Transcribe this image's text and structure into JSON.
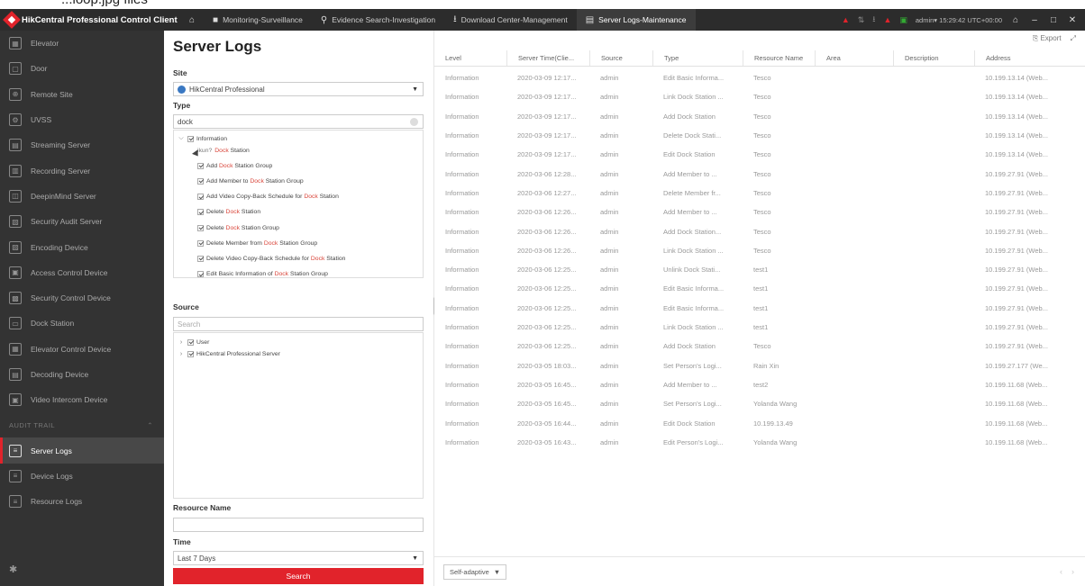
{
  "caption": "...loop.jpg files",
  "titlebar": {
    "app_name": "HikCentral Professional Control Client",
    "tabs": [
      {
        "label": "Monitoring-Surveillance"
      },
      {
        "label": "Evidence Search-Investigation"
      },
      {
        "label": "Download Center-Management"
      },
      {
        "label": "Server Logs-Maintenance"
      }
    ],
    "user": "admin▾ 15:29:42 UTC+00:00"
  },
  "sidebar": {
    "items": [
      {
        "label": "Elevator",
        "icon": "elevator-icon"
      },
      {
        "label": "Door",
        "icon": "door-icon"
      },
      {
        "label": "Remote Site",
        "icon": "remote-site-icon"
      },
      {
        "label": "UVSS",
        "icon": "uvss-icon"
      },
      {
        "label": "Streaming Server",
        "icon": "streaming-server-icon"
      },
      {
        "label": "Recording Server",
        "icon": "recording-server-icon"
      },
      {
        "label": "DeepinMind Server",
        "icon": "deepinmind-icon"
      },
      {
        "label": "Security Audit Server",
        "icon": "audit-server-icon"
      },
      {
        "label": "Encoding Device",
        "icon": "encoding-device-icon"
      },
      {
        "label": "Access Control Device",
        "icon": "access-control-icon"
      },
      {
        "label": "Security Control Device",
        "icon": "security-control-icon"
      },
      {
        "label": "Dock Station",
        "icon": "dock-station-icon"
      },
      {
        "label": "Elevator Control Device",
        "icon": "elevator-control-icon"
      },
      {
        "label": "Decoding Device",
        "icon": "decoding-device-icon"
      },
      {
        "label": "Video Intercom Device",
        "icon": "video-intercom-icon"
      }
    ],
    "section": "AUDIT TRAIL",
    "audit_items": [
      {
        "label": "Server Logs",
        "active": true
      },
      {
        "label": "Device Logs",
        "active": false
      },
      {
        "label": "Resource Logs",
        "active": false
      }
    ]
  },
  "filter": {
    "title": "Server Logs",
    "site_label": "Site",
    "site_value": "HikCentral Professional",
    "type_label": "Type",
    "type_value": "dock",
    "type_tree": {
      "parent": "Information",
      "ghost": "ikun?",
      "children": [
        {
          "pre": "",
          "hl": "Dock",
          "post": " Station"
        },
        {
          "pre": "Add ",
          "hl": "Dock",
          "post": " Station Group"
        },
        {
          "pre": "Add Member to ",
          "hl": "Dock",
          "post": " Station Group"
        },
        {
          "pre": "Add Video Copy-Back Schedule for ",
          "hl": "Dock",
          "post": " Station"
        },
        {
          "pre": "Delete ",
          "hl": "Dock",
          "post": " Station"
        },
        {
          "pre": "Delete ",
          "hl": "Dock",
          "post": " Station Group"
        },
        {
          "pre": "Delete Member from ",
          "hl": "Dock",
          "post": " Station Group"
        },
        {
          "pre": "Delete Video Copy-Back Schedule for ",
          "hl": "Dock",
          "post": " Station"
        },
        {
          "pre": "Edit Basic Information of ",
          "hl": "Dock",
          "post": " Station Group"
        }
      ]
    },
    "source_label": "Source",
    "source_placeholder": "Search",
    "source_tree": [
      "User",
      "HikCentral Professional Server"
    ],
    "resource_label": "Resource Name",
    "resource_value": "",
    "time_label": "Time",
    "time_value": "Last 7 Days",
    "search_label": "Search"
  },
  "table": {
    "export_label": "Export",
    "columns": [
      "Level",
      "Server Time(Clie...",
      "Source",
      "Type",
      "Resource Name",
      "Area",
      "Description",
      "Address"
    ],
    "rows": [
      [
        "Information",
        "2020-03-09 12:17...",
        "admin",
        "Edit Basic Informa...",
        "Tesco",
        "",
        "",
        "10.199.13.14 (Web..."
      ],
      [
        "Information",
        "2020-03-09 12:17...",
        "admin",
        "Link Dock Station ...",
        "Tesco",
        "",
        "",
        "10.199.13.14 (Web..."
      ],
      [
        "Information",
        "2020-03-09 12:17...",
        "admin",
        "Add Dock Station",
        "Tesco",
        "",
        "",
        "10.199.13.14 (Web..."
      ],
      [
        "Information",
        "2020-03-09 12:17...",
        "admin",
        "Delete Dock Stati...",
        "Tesco",
        "",
        "",
        "10.199.13.14 (Web..."
      ],
      [
        "Information",
        "2020-03-09 12:17...",
        "admin",
        "Edit Dock Station",
        "Tesco",
        "",
        "",
        "10.199.13.14 (Web..."
      ],
      [
        "Information",
        "2020-03-06 12:28...",
        "admin",
        "Add Member to ...",
        "Tesco",
        "",
        "",
        "10.199.27.91 (Web..."
      ],
      [
        "Information",
        "2020-03-06 12:27...",
        "admin",
        "Delete Member fr...",
        "Tesco",
        "",
        "",
        "10.199.27.91 (Web..."
      ],
      [
        "Information",
        "2020-03-06 12:26...",
        "admin",
        "Add Member to ...",
        "Tesco",
        "",
        "",
        "10.199.27.91 (Web..."
      ],
      [
        "Information",
        "2020-03-06 12:26...",
        "admin",
        "Add Dock Station...",
        "Tesco",
        "",
        "",
        "10.199.27.91 (Web..."
      ],
      [
        "Information",
        "2020-03-06 12:26...",
        "admin",
        "Link Dock Station ...",
        "Tesco",
        "",
        "",
        "10.199.27.91 (Web..."
      ],
      [
        "Information",
        "2020-03-06 12:25...",
        "admin",
        "Unlink Dock Stati...",
        "test1",
        "",
        "",
        "10.199.27.91 (Web..."
      ],
      [
        "Information",
        "2020-03-06 12:25...",
        "admin",
        "Edit Basic Informa...",
        "test1",
        "",
        "",
        "10.199.27.91 (Web..."
      ],
      [
        "Information",
        "2020-03-06 12:25...",
        "admin",
        "Edit Basic Informa...",
        "test1",
        "",
        "",
        "10.199.27.91 (Web..."
      ],
      [
        "Information",
        "2020-03-06 12:25...",
        "admin",
        "Link Dock Station ...",
        "test1",
        "",
        "",
        "10.199.27.91 (Web..."
      ],
      [
        "Information",
        "2020-03-06 12:25...",
        "admin",
        "Add Dock Station",
        "Tesco",
        "",
        "",
        "10.199.27.91 (Web..."
      ],
      [
        "Information",
        "2020-03-05 18:03...",
        "admin",
        "Set Person's Logi...",
        "Rain Xin",
        "",
        "",
        "10.199.27.177 (We..."
      ],
      [
        "Information",
        "2020-03-05 16:45...",
        "admin",
        "Add Member to ...",
        "test2",
        "",
        "",
        "10.199.11.68 (Web..."
      ],
      [
        "Information",
        "2020-03-05 16:45...",
        "admin",
        "Set Person's Logi...",
        "Yolanda Wang",
        "",
        "",
        "10.199.11.68 (Web..."
      ],
      [
        "Information",
        "2020-03-05 16:44...",
        "admin",
        "Edit Dock Station",
        "10.199.13.49",
        "",
        "",
        "10.199.11.68 (Web..."
      ],
      [
        "Information",
        "2020-03-05 16:43...",
        "admin",
        "Edit Person's Logi...",
        "Yolanda Wang",
        "",
        "",
        "10.199.11.68 (Web..."
      ]
    ],
    "page_mode": "Self-adaptive"
  }
}
